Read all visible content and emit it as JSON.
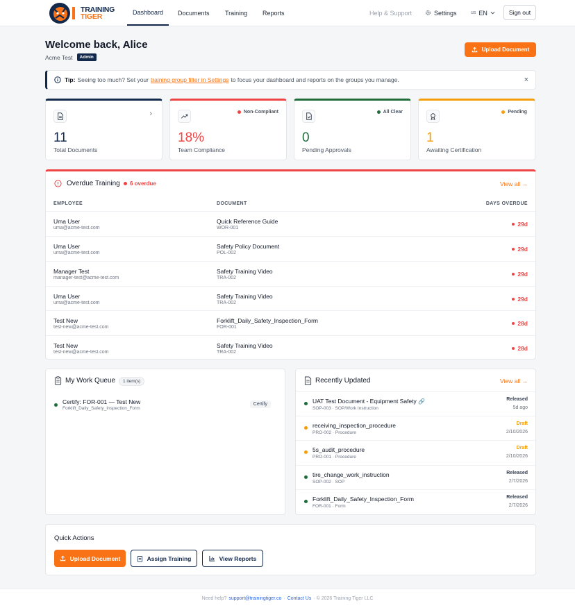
{
  "brand": {
    "line1": "TRAINING",
    "line2": "TIGER",
    "navy": "#13294b",
    "orange": "#f97316"
  },
  "nav": {
    "items": [
      "Dashboard",
      "Documents",
      "Training",
      "Reports"
    ],
    "active": "Dashboard",
    "help": "Help & Support",
    "settings": "Settings",
    "lang_flag": "us",
    "lang": "EN",
    "sign_out": "Sign out"
  },
  "welcome": {
    "title": "Welcome back, Alice",
    "org": "Acme Test",
    "role": "Admin",
    "upload": "Upload Document"
  },
  "tip": {
    "label": "Tip:",
    "before": "Seeing too much? Set your",
    "link": "training group filter in Settings",
    "after": "to focus your dashboard and reports on the groups you manage.",
    "close": "×"
  },
  "stats": [
    {
      "value": "11",
      "label": "Total Documents",
      "tag": "",
      "color": "#13294b",
      "icon": "document-icon"
    },
    {
      "value": "18%",
      "label": "Team Compliance",
      "tag": "Non-Compliant",
      "color": "#ef4444",
      "icon": "trending-up-icon"
    },
    {
      "value": "0",
      "label": "Pending Approvals",
      "tag": "All Clear",
      "color": "#1f6b3a",
      "icon": "file-check-icon"
    },
    {
      "value": "1",
      "label": "Awaiting Certification",
      "tag": "Pending",
      "color": "#f59e0b",
      "icon": "award-icon"
    }
  ],
  "overdue": {
    "title": "Overdue Training",
    "count": "6 overdue",
    "view_all": "View all →",
    "headers": [
      "EMPLOYEE",
      "DOCUMENT",
      "DAYS OVERDUE"
    ],
    "rows": [
      {
        "name": "Uma User",
        "email": "uma@acme-test.com",
        "doc": "Quick Reference Guide",
        "code": "WOR-001",
        "days": "29d"
      },
      {
        "name": "Uma User",
        "email": "uma@acme-test.com",
        "doc": "Safety Policy Document",
        "code": "POL-002",
        "days": "29d"
      },
      {
        "name": "Manager Test",
        "email": "manager-test@acme-test.com",
        "doc": "Safety Training Video",
        "code": "TRA-002",
        "days": "29d"
      },
      {
        "name": "Uma User",
        "email": "uma@acme-test.com",
        "doc": "Safety Training Video",
        "code": "TRA-002",
        "days": "29d"
      },
      {
        "name": "Test New",
        "email": "test-new@acme-test.com",
        "doc": "Forklift_Daily_Safety_Inspection_Form",
        "code": "FOR-001",
        "days": "28d"
      },
      {
        "name": "Test New",
        "email": "test-new@acme-test.com",
        "doc": "Safety Training Video",
        "code": "TRA-002",
        "days": "28d"
      }
    ]
  },
  "queue": {
    "title": "My Work Queue",
    "count": "1 item(s)",
    "items": [
      {
        "title": "Certify: FOR-001 — Test New",
        "sub": "Forklift_Daily_Safety_Inspection_Form",
        "action": "Certify"
      }
    ]
  },
  "recent": {
    "title": "Recently Updated",
    "view_all": "View all →",
    "items": [
      {
        "title": "UAT Test Document - Equipment Safety",
        "sub": "SOP-003 · SOP/Work Instruction",
        "status": "Released",
        "date": "5d ago",
        "color": "#1f6b3a",
        "link_icon": true
      },
      {
        "title": "receiving_inspection_procedure",
        "sub": "PRO-002 · Procedure",
        "status": "Draft",
        "date": "2/10/2026",
        "color": "#f59e0b",
        "link_icon": false
      },
      {
        "title": "5s_audit_procedure",
        "sub": "PRO-001 · Procedure",
        "status": "Draft",
        "date": "2/10/2026",
        "color": "#f59e0b",
        "link_icon": false
      },
      {
        "title": "tire_change_work_instruction",
        "sub": "SOP-002 · SOP",
        "status": "Released",
        "date": "2/7/2026",
        "color": "#1f6b3a",
        "link_icon": false
      },
      {
        "title": "Forklift_Daily_Safety_Inspection_Form",
        "sub": "FOR-001 · Form",
        "status": "Released",
        "date": "2/7/2026",
        "color": "#1f6b3a",
        "link_icon": false
      }
    ]
  },
  "quick": {
    "title": "Quick Actions",
    "upload": "Upload Document",
    "assign": "Assign Training",
    "reports": "View Reports"
  },
  "footer": {
    "help": "Need help?",
    "email": "support@trainingtiger.co",
    "sep": "·",
    "contact": "Contact Us",
    "copy": "· © 2026 Training Tiger LLC"
  }
}
